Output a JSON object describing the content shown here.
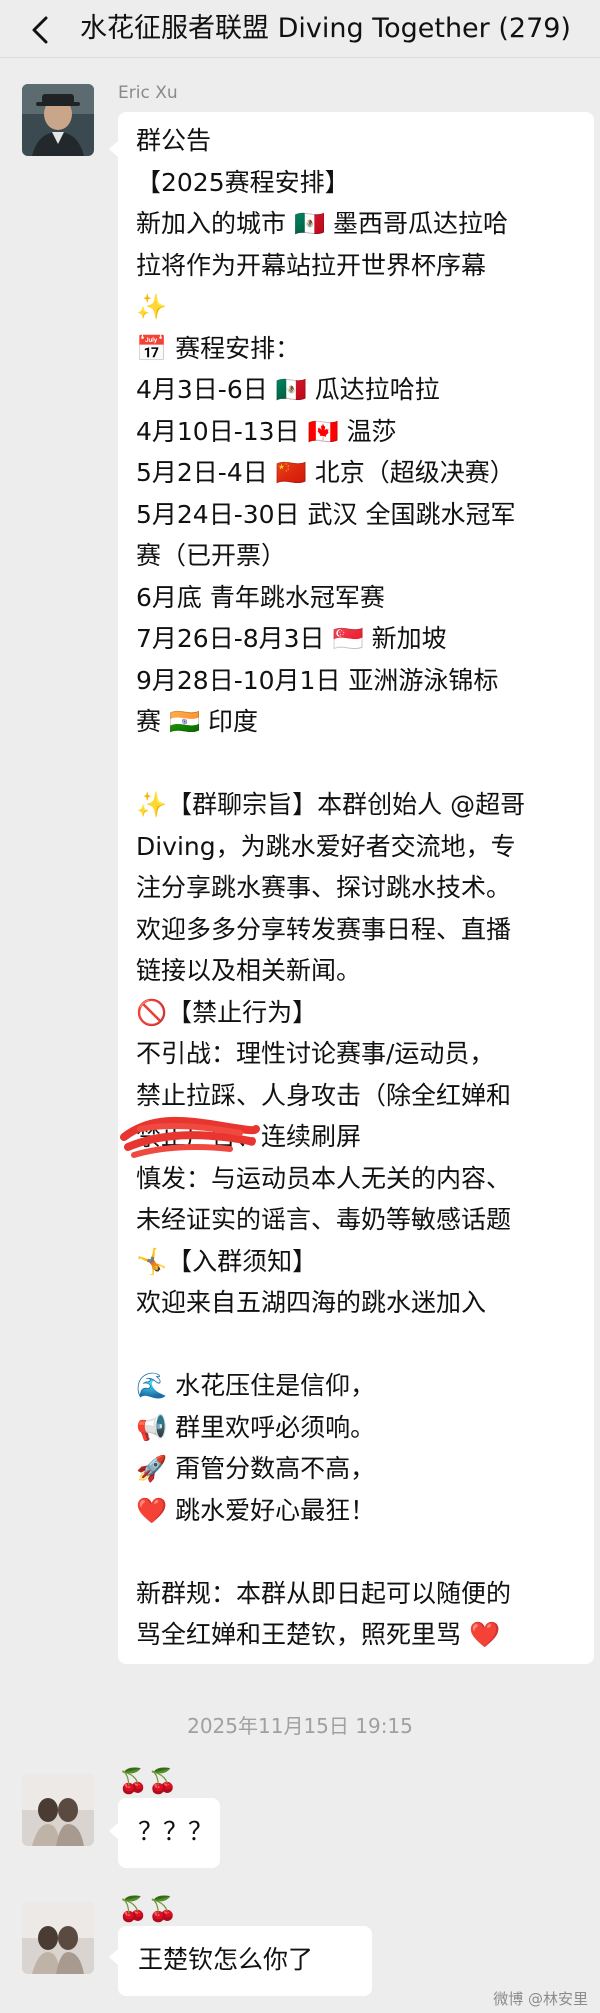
{
  "header": {
    "title": "水花征服者联盟 Diving Together (279)"
  },
  "first_message": {
    "sender": "Eric Xu",
    "lines": [
      "群公告",
      "【2025赛程安排】",
      "新加入的城市 🇲🇽 墨西哥瓜达拉哈",
      "拉将作为开幕站拉开世界杯序幕",
      "✨",
      "📅 赛程安排：",
      "4月3日-6日 🇲🇽 瓜达拉哈拉",
      "4月10日-13日 🇨🇦 温莎",
      "5月2日-4日 🇨🇳 北京（超级决赛）",
      "5月24日-30日 武汉 全国跳水冠军",
      "赛（已开票）",
      "6月底 青年跳水冠军赛",
      "7月26日-8月3日 🇸🇬 新加坡",
      "9月28日-10月1日 亚洲游泳锦标",
      "赛 🇮🇳 印度",
      "",
      "✨【群聊宗旨】本群创始人 @超哥",
      "Diving，为跳水爱好者交流地，专",
      "注分享跳水赛事、探讨跳水技术。",
      "欢迎多多分享转发赛事日程、直播",
      "链接以及相关新闻。",
      "🚫【禁止行为】",
      "不引战：理性讨论赛事/运动员，",
      "禁止拉踩、人身攻击（除全红婵和",
      "        禁止广告、连续刷屏",
      "慎发：与运动员本人无关的内容、",
      "未经证实的谣言、毒奶等敏感话题",
      "🤸【入群须知】",
      "欢迎来自五湖四海的跳水迷加入",
      "",
      "🌊 水花压住是信仰，",
      "📢 群里欢呼必须响。",
      "🚀 甭管分数高不高，",
      "❤️ 跳水爱好心最狂！",
      "",
      "新群规：本群从即日起可以随便的",
      "骂全红婵和王楚钦，照死里骂 ❤️"
    ]
  },
  "timestamp": "2025年11月15日 19:15",
  "second_message": {
    "sender": "🍒🍒",
    "text": "？？？"
  },
  "third_message": {
    "sender": "🍒🍒",
    "text": "王楚钦怎么你了"
  },
  "watermark": "微博 @林安里"
}
